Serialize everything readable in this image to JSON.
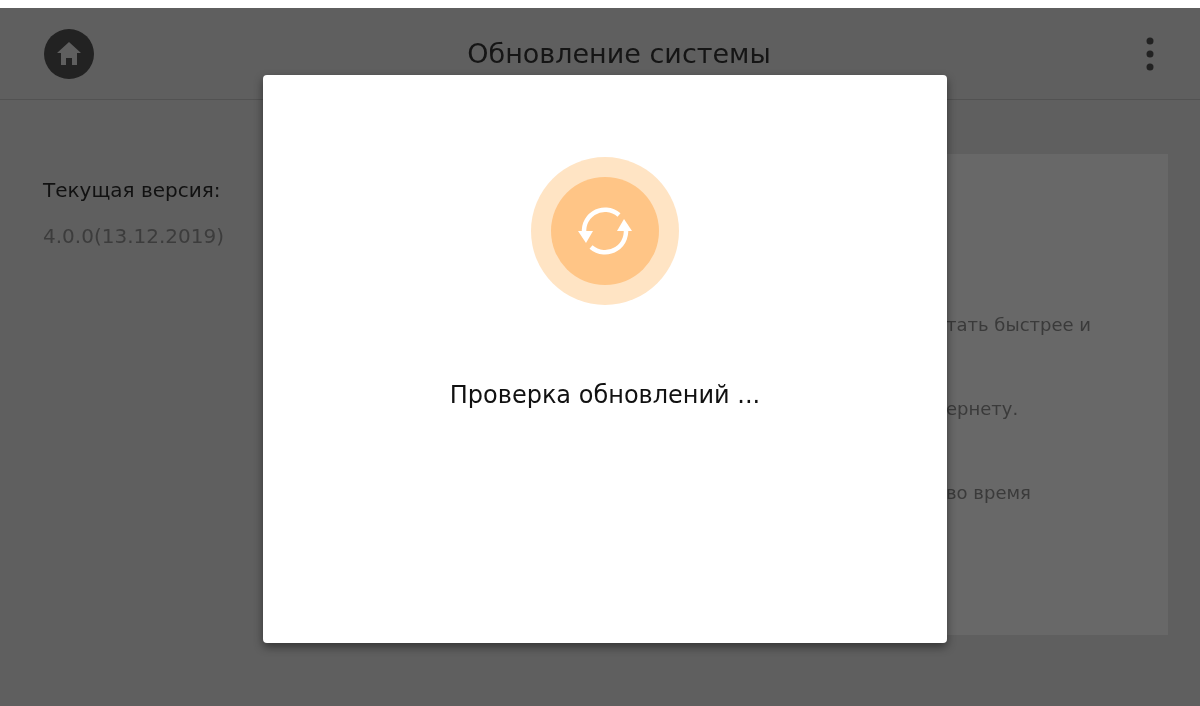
{
  "header": {
    "title": "Обновление системы"
  },
  "current_version": {
    "label": "Текущая версия:",
    "value": "4.0.0(13.12.2019)"
  },
  "info_panel": {
    "lines": [
      "тать быстрее и",
      "ернету.",
      "во время"
    ]
  },
  "dialog": {
    "message": "Проверка обновлений ..."
  }
}
